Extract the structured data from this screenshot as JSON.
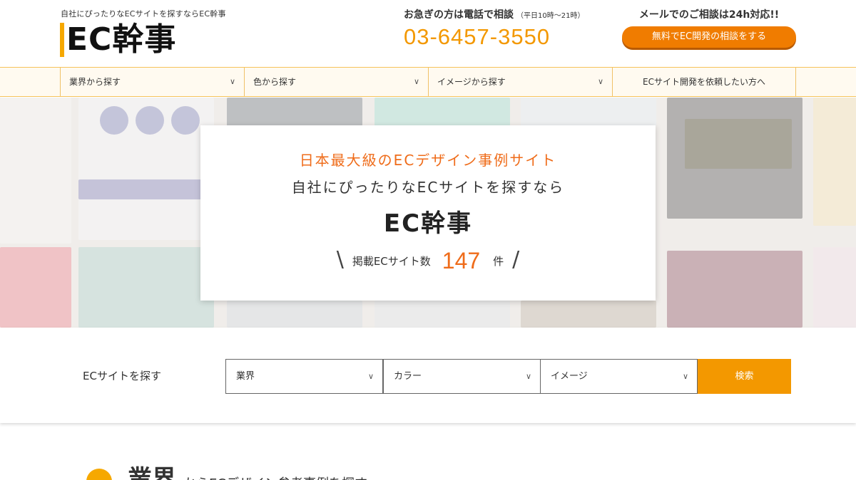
{
  "header": {
    "tagline": "自社にぴったりなECサイトを探すならEC幹事",
    "logo_text": "EC幹事",
    "tel_caption": "お急ぎの方は電話で相談",
    "tel_hours": "（平日10時～21時）",
    "tel_number": "03-6457-3550",
    "mail_caption": "メールでのご相談は24h対応!!",
    "consult_button": "無料でEC開発の相談をする"
  },
  "nav": {
    "items": [
      {
        "label": "業界から探す"
      },
      {
        "label": "色から探す"
      },
      {
        "label": "イメージから探す"
      },
      {
        "label": "ECサイト開発を依頼したい方へ"
      }
    ]
  },
  "hero": {
    "lead": "日本最大級のECデザイン事例サイト",
    "sub": "自社にぴったりなECサイトを探すなら",
    "title": "EC幹事",
    "count_label": "掲載ECサイト数",
    "count_value": "147",
    "count_unit": "件",
    "slash_left": "\\",
    "slash_right": "/"
  },
  "search": {
    "title": "ECサイトを探す",
    "selects": [
      {
        "value": "業界"
      },
      {
        "value": "カラー"
      },
      {
        "value": "イメージ"
      }
    ],
    "button": "検索"
  },
  "section": {
    "title": "業界",
    "desc": "からECデザイン参考事例を探す"
  },
  "icons": {
    "chevron": "chevron-down-icon"
  },
  "colors": {
    "accent_orange": "#f39800",
    "accent_deep_orange": "#ef6c1a",
    "nav_border": "#f6c35b",
    "logo_bar": "#f6a800"
  }
}
